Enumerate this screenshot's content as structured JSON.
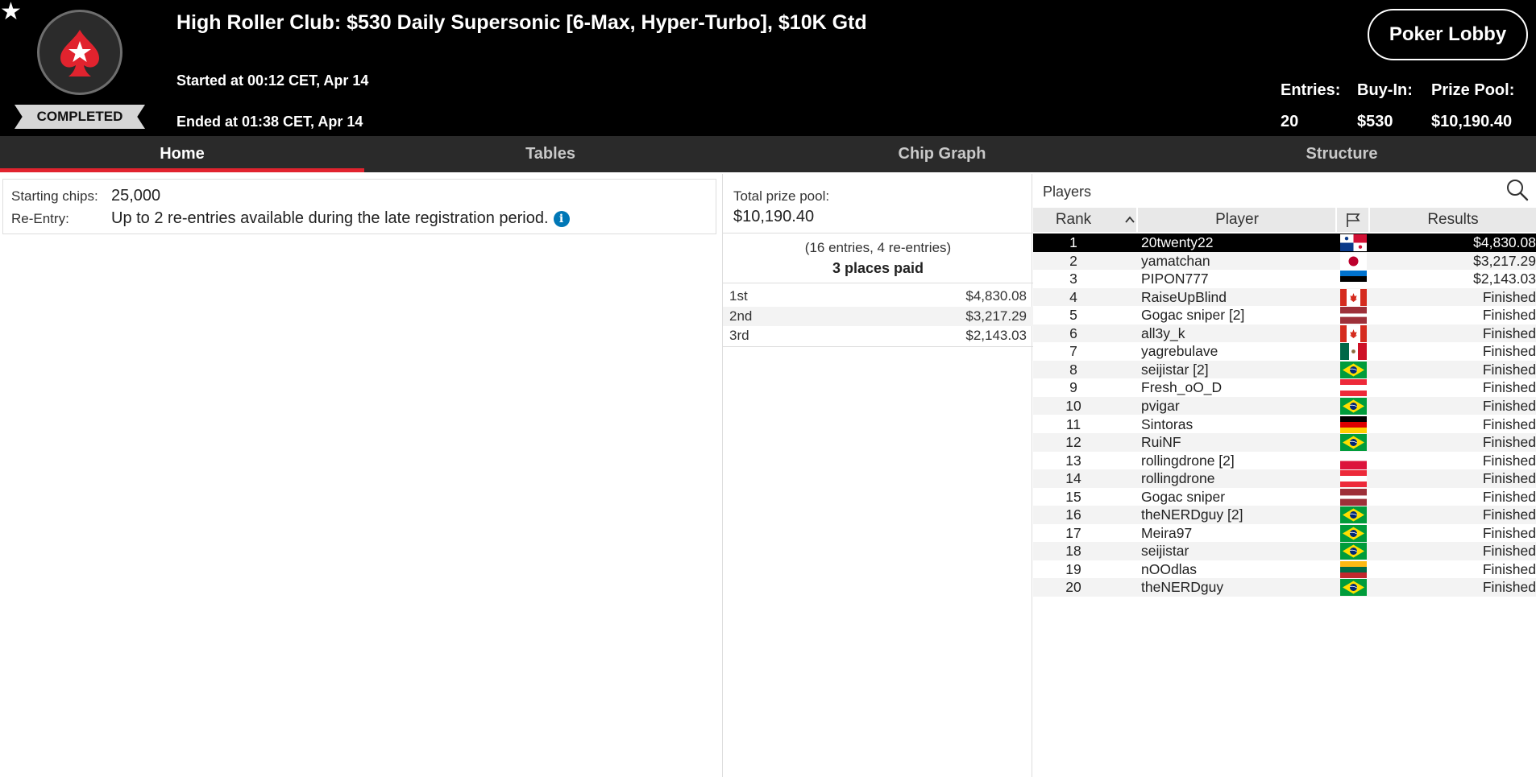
{
  "header": {
    "title": "High Roller Club: $530 Daily Supersonic [6-Max, Hyper-Turbo], $10K Gtd",
    "status": "COMPLETED",
    "started": "Started at 00:12 CET, Apr 14",
    "ended": "Ended at 01:38 CET, Apr 14",
    "lobby_button": "Poker Lobby",
    "entries_label": "Entries:",
    "entries_value": "20",
    "buyin_label": "Buy-In:",
    "buyin_value": "$530",
    "prizepool_label": "Prize Pool:",
    "prizepool_value": "$10,190.40"
  },
  "tabs": [
    {
      "label": "Home",
      "active": true
    },
    {
      "label": "Tables",
      "active": false
    },
    {
      "label": "Chip Graph",
      "active": false
    },
    {
      "label": "Structure",
      "active": false
    }
  ],
  "info": {
    "starting_chips_label": "Starting chips:",
    "starting_chips_value": "25,000",
    "reentry_label": "Re-Entry:",
    "reentry_value": "Up to 2 re-entries available during the late registration period.",
    "info_icon_glyph": "i"
  },
  "prize": {
    "total_label": "Total prize pool:",
    "total_value": "$10,190.40",
    "entries_note": "(16 entries, 4 re-entries)",
    "places_paid": "3 places paid",
    "payouts": [
      {
        "place": "1st",
        "amount": "$4,830.08"
      },
      {
        "place": "2nd",
        "amount": "$3,217.29"
      },
      {
        "place": "3rd",
        "amount": "$2,143.03"
      }
    ]
  },
  "players": {
    "title": "Players",
    "columns": {
      "rank": "Rank",
      "player": "Player",
      "results": "Results"
    },
    "sort_indicator": "^",
    "rows": [
      {
        "rank": "1",
        "name": "20twenty22",
        "flag": "panama",
        "result": "$4,830.08",
        "selected": true
      },
      {
        "rank": "2",
        "name": "yamatchan",
        "flag": "japan",
        "result": "$3,217.29"
      },
      {
        "rank": "3",
        "name": "PIPON777",
        "flag": "estonia",
        "result": "$2,143.03"
      },
      {
        "rank": "4",
        "name": "RaiseUpBlind",
        "flag": "canada",
        "result": "Finished"
      },
      {
        "rank": "5",
        "name": "Gogac sniper [2]",
        "flag": "latvia",
        "result": "Finished"
      },
      {
        "rank": "6",
        "name": "all3y_k",
        "flag": "canada",
        "result": "Finished"
      },
      {
        "rank": "7",
        "name": "yagrebulave",
        "flag": "mexico",
        "result": "Finished"
      },
      {
        "rank": "8",
        "name": "seijistar [2]",
        "flag": "brazil",
        "result": "Finished"
      },
      {
        "rank": "9",
        "name": "Fresh_oO_D",
        "flag": "austria",
        "result": "Finished"
      },
      {
        "rank": "10",
        "name": "pvigar",
        "flag": "brazil",
        "result": "Finished"
      },
      {
        "rank": "11",
        "name": "Sintoras",
        "flag": "germany",
        "result": "Finished"
      },
      {
        "rank": "12",
        "name": "RuiNF",
        "flag": "brazil",
        "result": "Finished"
      },
      {
        "rank": "13",
        "name": "rollingdrone [2]",
        "flag": "poland",
        "result": "Finished"
      },
      {
        "rank": "14",
        "name": "rollingdrone",
        "flag": "austria",
        "result": "Finished"
      },
      {
        "rank": "15",
        "name": "Gogac sniper",
        "flag": "latvia",
        "result": "Finished"
      },
      {
        "rank": "16",
        "name": "theNERDguy [2]",
        "flag": "brazil",
        "result": "Finished"
      },
      {
        "rank": "17",
        "name": "Meira97",
        "flag": "brazil",
        "result": "Finished"
      },
      {
        "rank": "18",
        "name": "seijistar",
        "flag": "brazil",
        "result": "Finished"
      },
      {
        "rank": "19",
        "name": "nOOdlas",
        "flag": "lithuania",
        "result": "Finished"
      },
      {
        "rank": "20",
        "name": "theNERDguy",
        "flag": "brazil",
        "result": "Finished"
      }
    ]
  },
  "colors": {
    "header_bg": "#000000",
    "tab_bar_bg": "#2a2a2a",
    "accent_red": "#e1232e",
    "selected_row_bg": "#000000",
    "info_icon_blue": "#0077b6"
  }
}
